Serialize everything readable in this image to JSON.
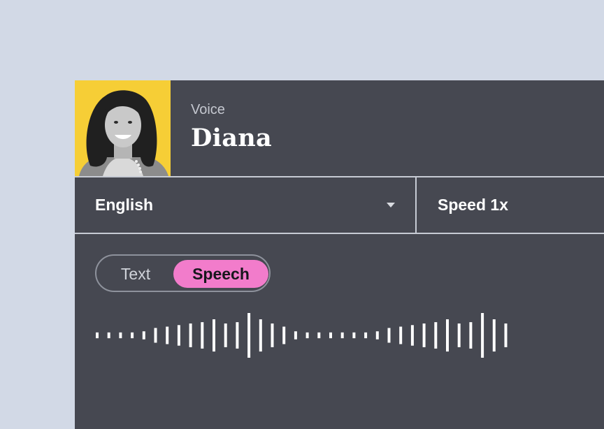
{
  "voice": {
    "label": "Voice",
    "name": "Diana"
  },
  "language": {
    "selected": "English"
  },
  "speed": {
    "label": "Speed 1x"
  },
  "mode_toggle": {
    "options": [
      "Text",
      "Speech"
    ],
    "active": "Speech"
  },
  "colors": {
    "background": "#d2d9e6",
    "panel": "#464851",
    "avatar_bg": "#f6ce36",
    "accent": "#f27ccb"
  },
  "waveform": {
    "levels": [
      0.13,
      0.13,
      0.13,
      0.13,
      0.18,
      0.33,
      0.39,
      0.46,
      0.53,
      0.59,
      0.72,
      0.53,
      0.59,
      1.0,
      0.72,
      0.53,
      0.39,
      0.18,
      0.13,
      0.13,
      0.13,
      0.13,
      0.13,
      0.13,
      0.18,
      0.33,
      0.39,
      0.46,
      0.53,
      0.59,
      0.72,
      0.53,
      0.59,
      1.0,
      0.72,
      0.53,
      0.39
    ]
  }
}
